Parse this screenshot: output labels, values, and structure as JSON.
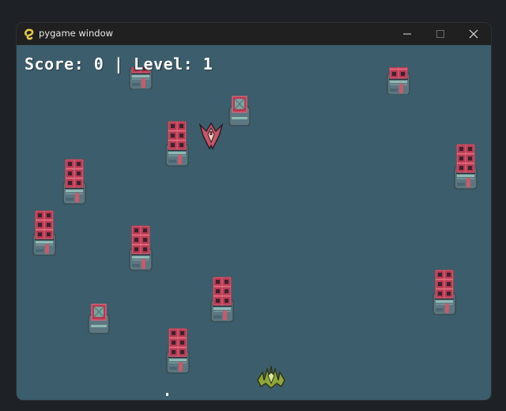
{
  "window": {
    "title": "pygame window",
    "app_icon": "python-snake-icon",
    "controls": {
      "minimize": "minimize-icon",
      "maximize": "maximize-icon",
      "close": "close-icon"
    }
  },
  "hud": {
    "text": "Score: 0 | Level: 1"
  },
  "colors": {
    "background": "#3c5d6b",
    "titlebar": "#202020",
    "hud_text": "#ffffff",
    "crate_red": "#b73a52",
    "player_green": "#8fa63a"
  },
  "sprites": {
    "obstacles": "stacked-red-crate-machine",
    "single_obstacles": "single-crate-machine",
    "enemy": "red-alien-fighter",
    "player": "green-player-ship",
    "projectile": "white-bullet"
  }
}
